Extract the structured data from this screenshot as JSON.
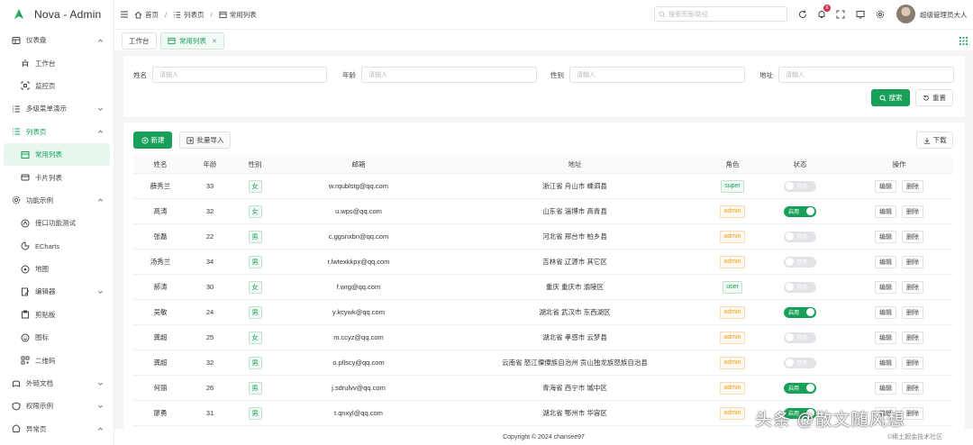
{
  "app": {
    "name": "Nova - Admin",
    "brand_color": "#18a058"
  },
  "sidebar": {
    "items": [
      {
        "label": "仪表盘",
        "icon": "dashboard-icon",
        "caret": "up"
      },
      {
        "label": "工作台",
        "icon": "workbench-icon",
        "sub": true
      },
      {
        "label": "监控页",
        "icon": "monitor-icon",
        "sub": true
      },
      {
        "label": "多级菜单演示",
        "icon": "list-icon",
        "caret": "down"
      },
      {
        "label": "列表页",
        "icon": "list-icon",
        "caret": "up",
        "open": true
      },
      {
        "label": "常用列表",
        "icon": "table-icon",
        "sub": true,
        "active": true
      },
      {
        "label": "卡片列表",
        "icon": "card-icon",
        "sub": true
      },
      {
        "label": "功能示例",
        "icon": "function-icon",
        "caret": "up"
      },
      {
        "label": "接口功能测试",
        "icon": "api-icon",
        "sub": true
      },
      {
        "label": "ECharts",
        "icon": "chart-icon",
        "sub": true
      },
      {
        "label": "地图",
        "icon": "map-icon",
        "sub": true
      },
      {
        "label": "编辑器",
        "icon": "editor-icon",
        "sub": true,
        "caret": "down"
      },
      {
        "label": "剪贴板",
        "icon": "clipboard-icon",
        "sub": true
      },
      {
        "label": "图标",
        "icon": "emoji-icon",
        "sub": true
      },
      {
        "label": "二维码",
        "icon": "qrcode-icon",
        "sub": true
      },
      {
        "label": "外链文档",
        "icon": "link-icon",
        "caret": "down"
      },
      {
        "label": "权限示例",
        "icon": "permission-icon",
        "caret": "down"
      },
      {
        "label": "异常页",
        "icon": "error-icon",
        "caret": "up"
      }
    ]
  },
  "header": {
    "breadcrumb": [
      "首页",
      "列表页",
      "常用列表"
    ],
    "search_placeholder": "搜索页面/路径",
    "notification_count": "6",
    "username": "超级管理员大人"
  },
  "tabs": [
    {
      "label": "工作台",
      "active": false
    },
    {
      "label": "常用列表",
      "active": true
    }
  ],
  "search_form": {
    "fields": [
      {
        "label": "姓名",
        "placeholder": "请输入"
      },
      {
        "label": "年龄",
        "placeholder": "请输入"
      },
      {
        "label": "性别",
        "placeholder": "请输入"
      },
      {
        "label": "地址",
        "placeholder": "请输入"
      }
    ],
    "search_label": "搜索",
    "reset_label": "重置"
  },
  "table": {
    "new_label": "新建",
    "import_label": "批量导入",
    "download_label": "下载",
    "columns": [
      "姓名",
      "年龄",
      "性别",
      "邮箱",
      "地址",
      "角色",
      "状态",
      "操作"
    ],
    "edit_label": "编辑",
    "delete_label": "删除",
    "status_on_label": "启用",
    "status_off_label": "禁用",
    "rows": [
      {
        "name": "薛秀兰",
        "age": "33",
        "gender": "女",
        "email": "w.rqublstg@qq.com",
        "address": "浙江省 舟山市 嵊泗县",
        "role": "super",
        "status": false
      },
      {
        "name": "高涛",
        "age": "32",
        "gender": "女",
        "email": "u.wps@qq.com",
        "address": "山东省 淄博市 高青县",
        "role": "admin",
        "status": true
      },
      {
        "name": "张磊",
        "age": "22",
        "gender": "男",
        "email": "c.ggsnxbn@qq.com",
        "address": "河北省 邢台市 柏乡县",
        "role": "admin",
        "status": false
      },
      {
        "name": "汤秀兰",
        "age": "34",
        "gender": "男",
        "email": "r.lwtexkkpx@qq.com",
        "address": "吉林省 辽源市 其它区",
        "role": "admin",
        "status": false
      },
      {
        "name": "郝涛",
        "age": "30",
        "gender": "女",
        "email": "f.wrg@qq.com",
        "address": "重庆 重庆市 渝陵区",
        "role": "user",
        "status": false
      },
      {
        "name": "吴敏",
        "age": "24",
        "gender": "男",
        "email": "y.kcywk@qq.com",
        "address": "湖北省 武汉市 东西湖区",
        "role": "admin",
        "status": true
      },
      {
        "name": "龚超",
        "age": "25",
        "gender": "女",
        "email": "m.ccyz@qq.com",
        "address": "湖北省 孝感市 云梦县",
        "role": "admin",
        "status": false
      },
      {
        "name": "龚超",
        "age": "32",
        "gender": "男",
        "email": "o.pllscy@qq.com",
        "address": "云南省 怒江傈僳族自治州 贡山独龙族怒族自治县",
        "role": "admin",
        "status": false
      },
      {
        "name": "何丽",
        "age": "26",
        "gender": "男",
        "email": "j.sdrulvv@qq.com",
        "address": "青海省 西宁市 城中区",
        "role": "admin",
        "status": true
      },
      {
        "name": "廖勇",
        "age": "31",
        "gender": "男",
        "email": "t.qnxyl@qq.com",
        "address": "湖北省 鄂州市 华容区",
        "role": "admin",
        "status": true
      }
    ]
  },
  "footer": {
    "copyright": "Copyright © 2024 chansee97"
  },
  "watermark": {
    "text": "头条 @散文随风想",
    "sub": "©稀土掘金技术社区"
  }
}
